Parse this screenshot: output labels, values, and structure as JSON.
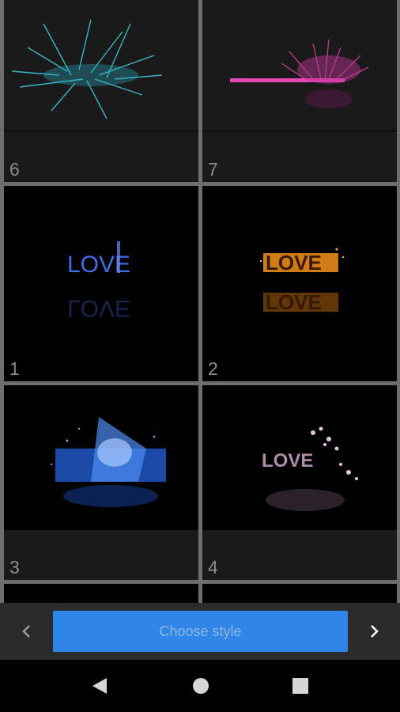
{
  "tiles": [
    {
      "label": "6"
    },
    {
      "label": "7"
    },
    {
      "label": "1"
    },
    {
      "label": "2"
    },
    {
      "label": "3"
    },
    {
      "label": "4"
    }
  ],
  "effects": {
    "love_text": "LOVE"
  },
  "bottom_bar": {
    "choose_label": "Choose style",
    "prev_icon": "chevron-left-icon",
    "next_icon": "chevron-right-icon"
  },
  "system_nav": {
    "back_icon": "back-triangle-icon",
    "home_icon": "home-circle-icon",
    "recents_icon": "recents-square-icon"
  },
  "colors": {
    "accent": "#2f86e6",
    "bar": "#2b2b2b",
    "grid_line": "#6e6e6e"
  }
}
